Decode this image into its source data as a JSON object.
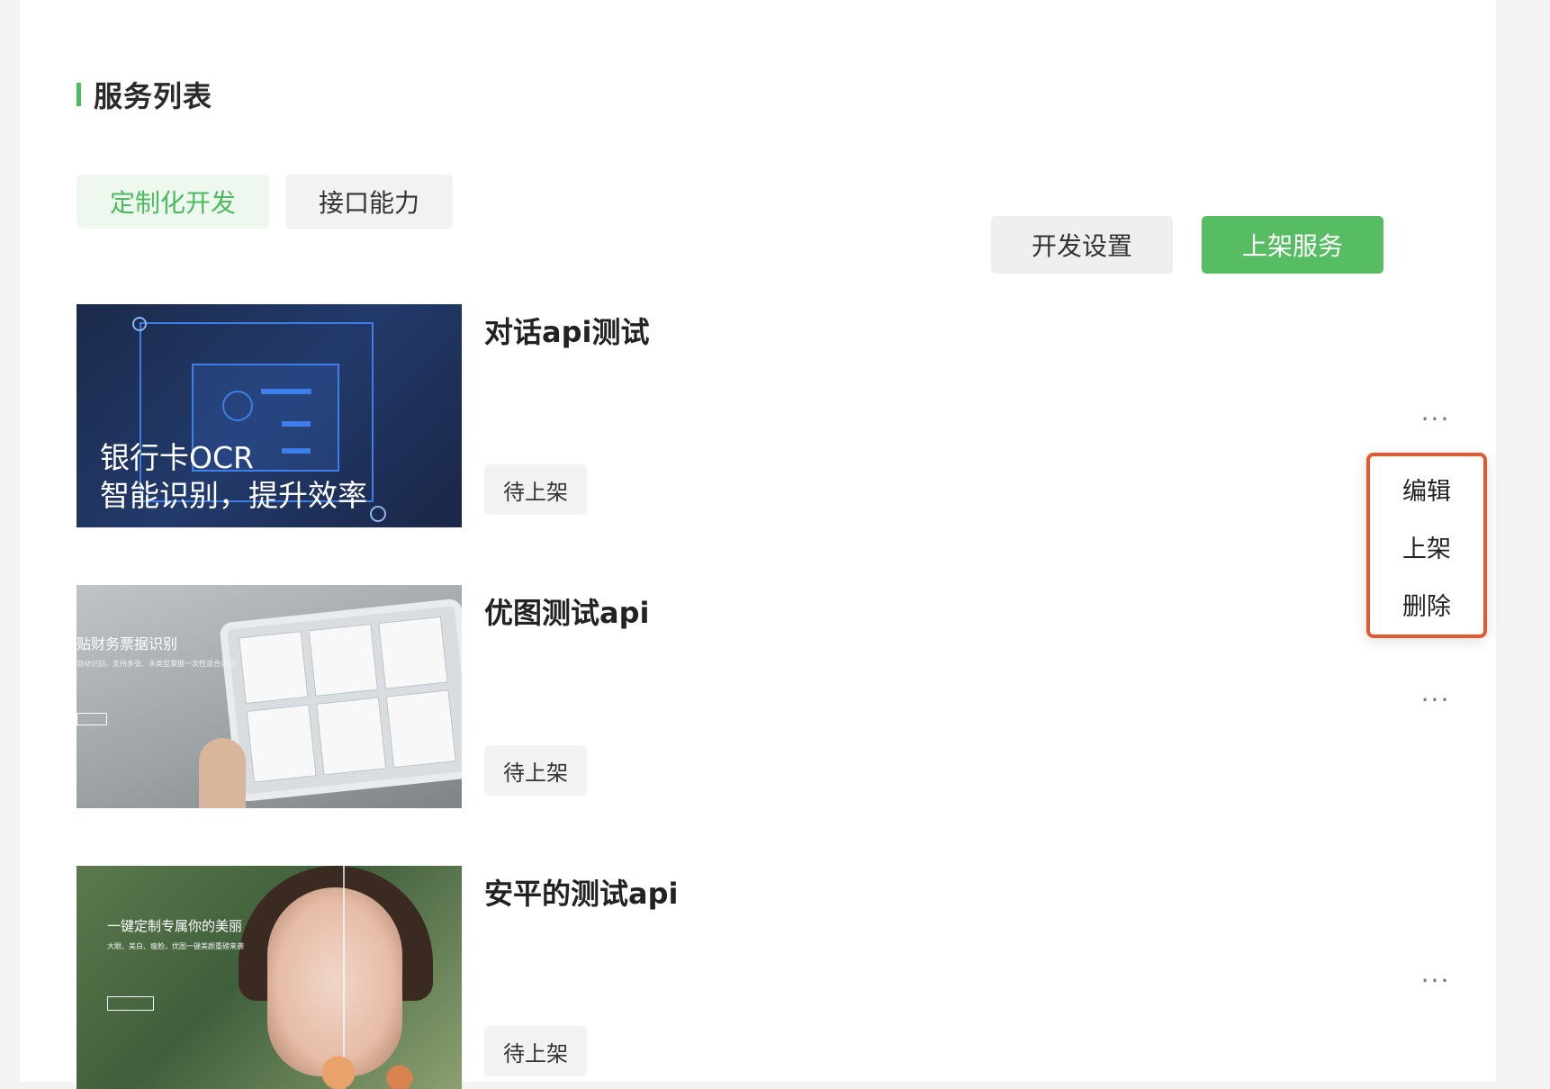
{
  "section": {
    "title": "服务列表"
  },
  "tabs": [
    {
      "label": "定制化开发",
      "active": true
    },
    {
      "label": "接口能力",
      "active": false
    }
  ],
  "actions": {
    "dev_settings_label": "开发设置",
    "publish_label": "上架服务"
  },
  "services": [
    {
      "title": "对话api测试",
      "status": "待上架",
      "thumb_caption_line1": "银行卡OCR",
      "thumb_caption_line2": "智能识别，提升效率",
      "more_label": "···"
    },
    {
      "title": "优图测试api",
      "status": "待上架",
      "thumb_caption": "贴财务票据识别",
      "thumb_sub": "自动识别，支持多张、多类型票据一次性混合识别",
      "more_label": "···"
    },
    {
      "title": "安平的测试api",
      "status": "待上架",
      "thumb_caption": "一键定制专属你的美丽",
      "thumb_sub": "大眼、美白、瘦脸，优图一键美颜重磅来袭",
      "more_label": "···"
    }
  ],
  "menu": {
    "items": [
      "编辑",
      "上架",
      "删除"
    ]
  },
  "colors": {
    "accent": "#57bd62",
    "menu_highlight": "#e3582f"
  }
}
